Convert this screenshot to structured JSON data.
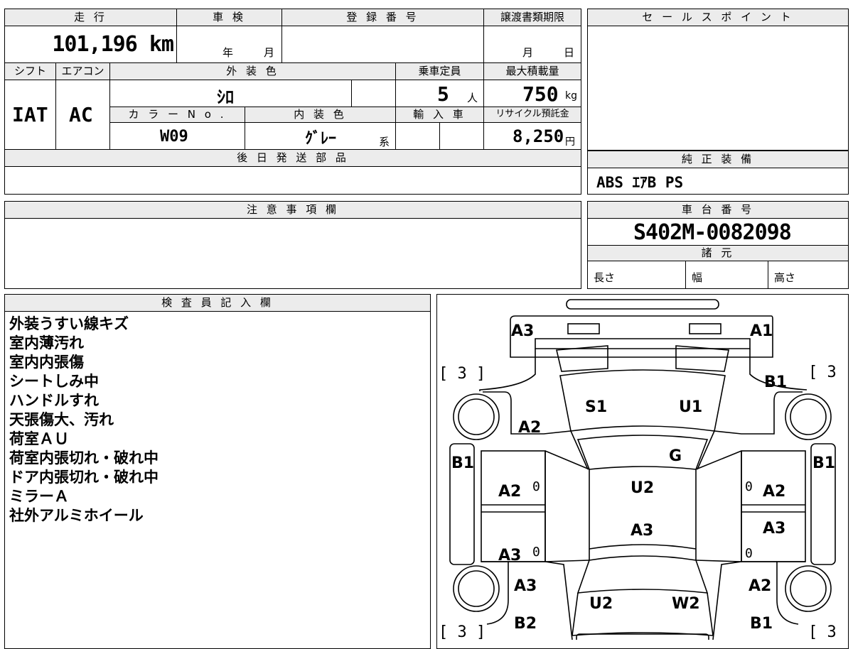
{
  "headers": {
    "mileage": "走 行",
    "shaken": "車 検",
    "registration": "登 録 番 号",
    "transfer_deadline": "譲渡書類期限",
    "sales_point": "セ ー ル ス ポ イ ン ト",
    "shift": "シフト",
    "aircon": "エアコン",
    "exterior_color": "外 装 色",
    "capacity": "乗車定員",
    "max_load": "最大積載量",
    "color_no": "カ ラ ー N o .",
    "interior_color": "内 装 色",
    "import": "輸 入 車",
    "recycle": "リサイクル預託金",
    "later_parts": "後 日 発 送 部 品",
    "oem_equipment": "純 正 装 備",
    "caution": "注 意 事 項 欄",
    "chassis_no": "車 台 番 号",
    "specs": "諸 元",
    "inspector_notes": "検 査 員 記 入 欄"
  },
  "values": {
    "mileage": "101,196 km",
    "shaken_year": "年",
    "shaken_month": "月",
    "deadline_month": "月",
    "deadline_day": "日",
    "shift": "IAT",
    "aircon": "AC",
    "exterior_color": "ｼﾛ",
    "capacity": "5",
    "capacity_unit": "人",
    "max_load": "750",
    "max_load_unit": "kg",
    "color_no": "W09",
    "interior_color": "ｸﾞﾚｰ",
    "interior_suffix": "系",
    "recycle": "8,250",
    "recycle_unit": "円",
    "oem_equipment": "ABS ｴｱB PS",
    "chassis_no": "S402M-0082098",
    "length_label": "長さ",
    "width_label": "幅",
    "height_label": "高さ"
  },
  "notes": [
    "外装うすい線キズ",
    "室内薄汚れ",
    "室内内張傷",
    "シートしみ中",
    "ハンドルすれ",
    "天張傷大、汚れ",
    "荷室ＡＵ",
    "荷室内張切れ・破れ中",
    "ドア内張切れ・破れ中",
    "ミラーＡ",
    "社外アルミホイール"
  ],
  "diagram": {
    "tire_fl": "[ 3 ]",
    "tire_fr": "[ 3 ]",
    "tire_rl": "[ 3 ]",
    "tire_rr": "[ 3 ]",
    "a3_top_left": "A3",
    "a1_top_right": "A1",
    "b1_right_upper": "B1",
    "s1": "S1",
    "u1": "U1",
    "a2_left_upper": "A2",
    "g": "G",
    "b1_left_side": "B1",
    "b1_right_side": "B1",
    "a2_left_mid": "A2",
    "zero_left_mid": "0",
    "u2_center": "U2",
    "zero_right_mid": "0",
    "a2_right_mid": "A2",
    "a3_center": "A3",
    "a3_right_lower": "A3",
    "a3_left_lower": "A3",
    "zero_left_lower": "0",
    "zero_right_lower": "0",
    "a3_left_bottom": "A3",
    "a2_right_bottom": "A2",
    "u2_bottom": "U2",
    "w2_bottom": "W2",
    "b2_bottom": "B2",
    "b1_bottom": "B1"
  }
}
